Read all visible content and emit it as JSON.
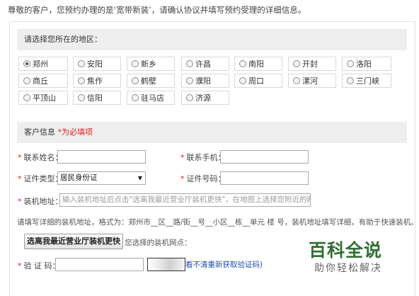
{
  "intro": "尊敬的客户，您预约办理的是‘宽带新装’，请确认协议并填写预约受理的详细信息。",
  "region": {
    "title": "请选择您所在的地区：",
    "items": [
      {
        "label": "郑州",
        "selected": true
      },
      {
        "label": "安阳",
        "selected": false
      },
      {
        "label": "新乡",
        "selected": false
      },
      {
        "label": "许昌",
        "selected": false
      },
      {
        "label": "南阳",
        "selected": false
      },
      {
        "label": "开封",
        "selected": false
      },
      {
        "label": "洛阳",
        "selected": false
      },
      {
        "label": "商丘",
        "selected": false
      },
      {
        "label": "焦作",
        "selected": false
      },
      {
        "label": "鹤壁",
        "selected": false
      },
      {
        "label": "濮阳",
        "selected": false
      },
      {
        "label": "周口",
        "selected": false
      },
      {
        "label": "漯河",
        "selected": false
      },
      {
        "label": "三门峡",
        "selected": false
      },
      {
        "label": "平顶山",
        "selected": false
      },
      {
        "label": "信阳",
        "selected": false
      },
      {
        "label": "驻马店",
        "selected": false
      },
      {
        "label": "济源",
        "selected": false
      }
    ]
  },
  "customer": {
    "title": "客户信息",
    "required_note": "*为必填项",
    "contact_name_label": "联系姓名：",
    "contact_phone_label": "联系手机：",
    "id_type_label": "证件类型：",
    "id_type_value": "居民身份证",
    "id_number_label": "证件号码：",
    "address_label": "装机地址：",
    "address_placeholder": "输入装机地址后点击\"选离我最近营业厅装机更快\"，在地图上选择您附近的网点",
    "address_hint": "请填写详细的装机地址，格式为：郑州市__区__路/街__号__小区__栋__单元 楼 号，装机地址填写详细，有助于快速装机。",
    "nearest_button": "选离我最近营业厅装机更快",
    "selected_point_label": "您选择的装机网点：",
    "captcha_label": "验 证 码：",
    "captcha_refresh": "看不清重新获取验证码)"
  },
  "watermark": {
    "title": "百科全说",
    "subtitle": "助你轻松解决"
  }
}
